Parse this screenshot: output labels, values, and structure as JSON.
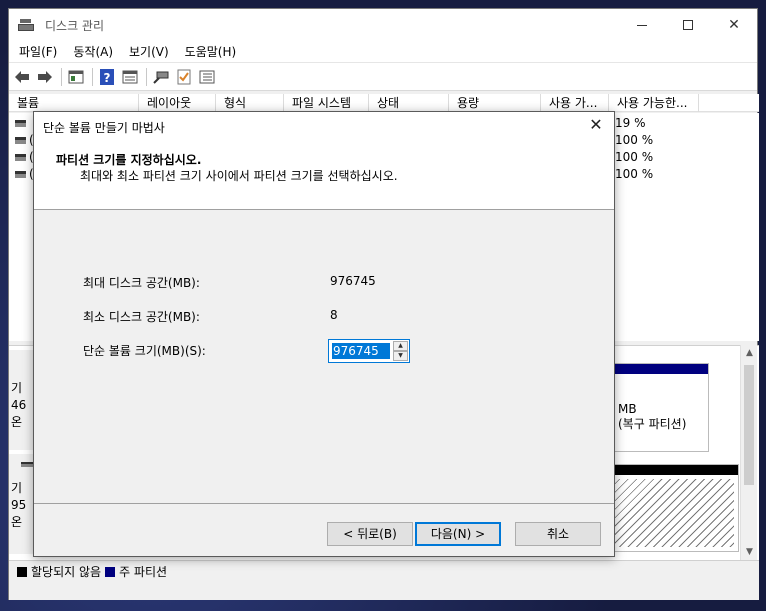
{
  "window": {
    "title": "디스크 관리",
    "controls": {
      "minimize": "minimize-icon",
      "maximize": "maximize-icon",
      "close": "✕"
    }
  },
  "menubar": [
    "파일(F)",
    "동작(A)",
    "보기(V)",
    "도움말(H)"
  ],
  "toolbar": [
    "back-arrow-icon",
    "forward-arrow-icon",
    "properties-icon",
    "help-icon",
    "view-icon",
    "connect-icon",
    "check-icon",
    "list-icon"
  ],
  "list_columns": [
    "볼륨",
    "레이아웃",
    "형식",
    "파일 시스템",
    "상태",
    "용량",
    "사용 가...",
    "사용 가능한..."
  ],
  "list_rows": [
    {
      "frag": "",
      "pct": "19 %"
    },
    {
      "frag": "(",
      "pct": "100 %"
    },
    {
      "frag": "(",
      "pct": "100 %"
    },
    {
      "frag": "(",
      "pct": "100 %"
    }
  ],
  "graph": {
    "disk1": [
      "기",
      "46",
      "온"
    ],
    "disk2": [
      "기",
      "95",
      "온"
    ],
    "partition": [
      "MB",
      "(복구 파티션)"
    ]
  },
  "legend": {
    "unallocated": "할당되지 않음",
    "primary": "주 파티션",
    "colors": {
      "unallocated": "#000000",
      "primary": "#00007f"
    }
  },
  "dialog": {
    "title": "단순 볼륨 만들기 마법사",
    "close": "✕",
    "heading": "파티션 크기를 지정하십시오.",
    "subheading": "최대와 최소 파티션 크기 사이에서 파티션 크기를 선택하십시오.",
    "fields": {
      "max_label": "최대 디스크 공간(MB):",
      "max_value": "976745",
      "min_label": "최소 디스크 공간(MB):",
      "min_value": "8",
      "size_label": "단순 볼륨 크기(MB)(S):",
      "size_value": "976745"
    },
    "buttons": {
      "back": "< 뒤로(B)",
      "next": "다음(N) >",
      "cancel": "취소"
    }
  }
}
